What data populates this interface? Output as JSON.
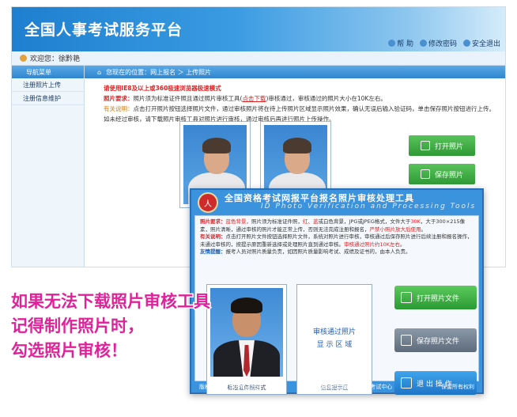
{
  "site": {
    "title": "全国人事考试服务平台",
    "toolbar": {
      "help": "帮 助",
      "change_password": "修改密码",
      "logout": "安全退出"
    },
    "welcome": "欢迎您：徐黔艳",
    "sidebar": {
      "head": "导航菜单",
      "items": [
        {
          "label": "注册照片上传"
        },
        {
          "label": "注册信息维护"
        }
      ]
    },
    "breadcrumb": "您现在的位置：网上报名 ＞ 上传照片",
    "notice": {
      "browser": "请使用IE8及以上或360极速浏览器极速模式",
      "photo_req_label": "照片要求：",
      "photo_req_a": "照片须为标准证件照且通过照片审核工具(",
      "photo_req_link": "点击下载",
      "photo_req_b": ")审核通过，审核通过的照片大小在10K左右。",
      "related_label": "有关说明：",
      "related_text": "点击打开照片按钮选择照片文件，通过审核照片将在待上传照片区域显示照片效果，确认无误后输入验证码，单击保存照片按钮进行上传。如未经过审核，请下载照片审核工具对照片进行审核，通过审核后再进行照片上传操作。"
    },
    "buttons": {
      "open": "打开照片",
      "save": "保存照片"
    }
  },
  "tool": {
    "title_cn": "全国资格考试网报平台报名照片审核处理工具",
    "title_en": "ID Photo Verification and Processing Tools",
    "seal_text": "人",
    "notice": {
      "req_label": "照片要求：",
      "req_a": "蓝色背景，",
      "req_b": "照片须为标准证件照，",
      "req_c": "红、蓝",
      "req_d": "或白色背景，JPG或JPEG格式，文件大于",
      "req_e": "30K",
      "req_f": "，大于300×215像素，照片清晰，通过审核的照片才能正常上传，否则无法完成注册和报名，",
      "req_g": "严禁小照片放大后使用",
      "req_h": "。",
      "inst_label": "有关说明：",
      "inst_a": "点击打开照片文件按钮选择照片文件，系统对照片进行审核，审核通过后保存照片进行后续注册和报名操作，未通过审核的，按提示原因重新选择或处理照片直到通过审核。",
      "inst_b": "审核通过照片约10K左右",
      "inst_c": "。",
      "tip_label": "友情提醒：",
      "tip_text": "报考人员对照片质量负责，如因照片质量影响考试、成绩及证书的，由本人负责。"
    },
    "photo_caption": "标准证件照样式",
    "result_line1": "审核通过照片",
    "result_line2": "显 示 区 域",
    "result_caption": "信息提示区",
    "buttons": {
      "open": "打开照片文件",
      "save": "保存照片文件",
      "exit": "退 出 操 作"
    },
    "footer": {
      "left": "版权所有 ©  2014-2024",
      "center": "人力资源社会保障部人事考试中心",
      "right": "保留所有权利"
    }
  },
  "caption": {
    "line1": "如果无法下载照片审核工具",
    "line2": "记得制作照片时，",
    "line3": "勾选照片审核！"
  }
}
